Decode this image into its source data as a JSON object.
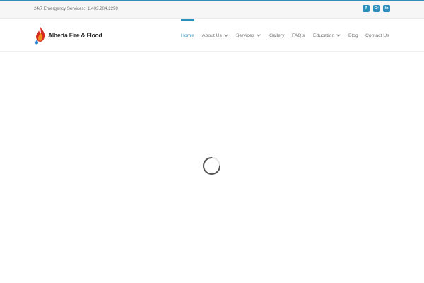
{
  "topbar": {
    "emergency_label": "24/7 Emergency Services:",
    "emergency_phone": "1.403.204.2259",
    "social": [
      {
        "icon": "facebook-icon",
        "glyph": "f"
      },
      {
        "icon": "google-plus-icon",
        "glyph": "G+"
      },
      {
        "icon": "linkedin-icon",
        "glyph": "in"
      }
    ]
  },
  "header": {
    "logo_text": "Alberta Fire & Flood",
    "nav": [
      {
        "label": "Home",
        "active": true
      },
      {
        "label": "About Us",
        "dropdown": true
      },
      {
        "label": "Services",
        "dropdown": true
      },
      {
        "label": "Gallery"
      },
      {
        "label": "FAQ's"
      },
      {
        "label": "Education",
        "dropdown": true
      },
      {
        "label": "Blog"
      },
      {
        "label": "Contact Us"
      }
    ]
  },
  "colors": {
    "accent": "#2a8fbd",
    "nav_text": "#747474",
    "topbar_bg": "#f6f6f6",
    "flame_red": "#d62a1e",
    "flame_orange": "#f28a1e",
    "water_blue": "#2a7fd6"
  },
  "content": {
    "loading": true,
    "spinner_icon": "loading-spinner-icon"
  }
}
